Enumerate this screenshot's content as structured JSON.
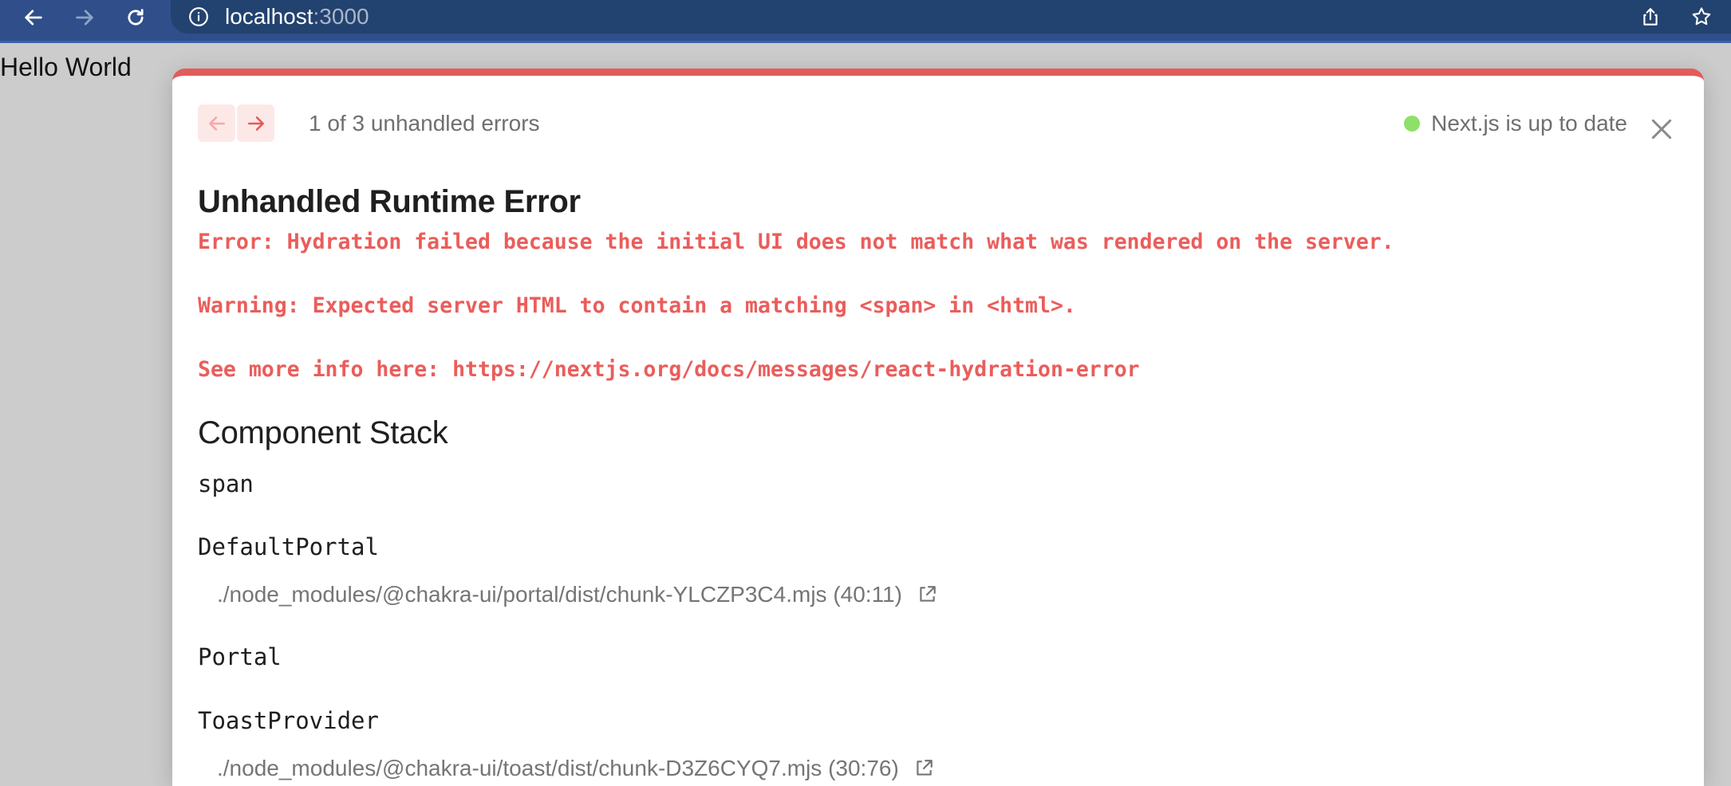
{
  "browser": {
    "url_host": "localhost",
    "url_port": ":3000"
  },
  "page": {
    "hello_text": "Hello World"
  },
  "overlay": {
    "pager_label": "1 of 3 unhandled errors",
    "status_text": "Next.js is up to date",
    "status_color": "#8fe069",
    "accent_color": "#e25c5a",
    "title": "Unhandled Runtime Error",
    "error_message": "Error: Hydration failed because the initial UI does not match what was rendered on the server.",
    "warning_message": "Warning: Expected server HTML to contain a matching <span> in <html>.",
    "info_prefix": "See more info here: ",
    "info_link": "https://nextjs.org/docs/messages/react-hydration-error",
    "stack_title": "Component Stack",
    "stack": [
      {
        "name": "span"
      },
      {
        "name": "DefaultPortal",
        "file": "./node_modules/@chakra-ui/portal/dist/chunk-YLCZP3C4.mjs (40:11)"
      },
      {
        "name": "Portal"
      },
      {
        "name": "ToastProvider",
        "file": "./node_modules/@chakra-ui/toast/dist/chunk-D3Z6CYQ7.mjs (30:76)"
      }
    ]
  }
}
